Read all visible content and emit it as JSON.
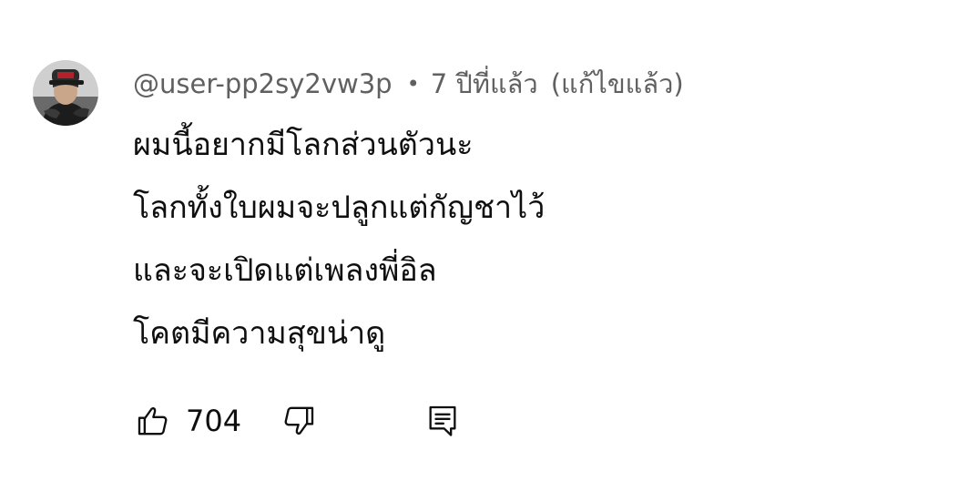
{
  "comment": {
    "author": "@user-pp2sy2vw3p",
    "separator": "•",
    "timestamp": "7 ปีที่แล้ว",
    "edited_label": "(แก้ไขแล้ว)",
    "text_lines": [
      "ผมนี้อยากมีโลกส่วนตัวนะ",
      "โลกทั้งใบผมจะปลูกแต่กัญชาไว้",
      "และจะเปิดแต่เพลงพี่อิล",
      "โคตมีความสุขน่าดู"
    ],
    "like_count": "704"
  },
  "icons": {
    "like": "thumbs-up-icon",
    "dislike": "thumbs-down-icon",
    "reply": "comment-reply-icon",
    "avatar": "user-avatar"
  },
  "colors": {
    "text": "#0f0f0f",
    "meta": "#606060",
    "background": "#ffffff"
  }
}
